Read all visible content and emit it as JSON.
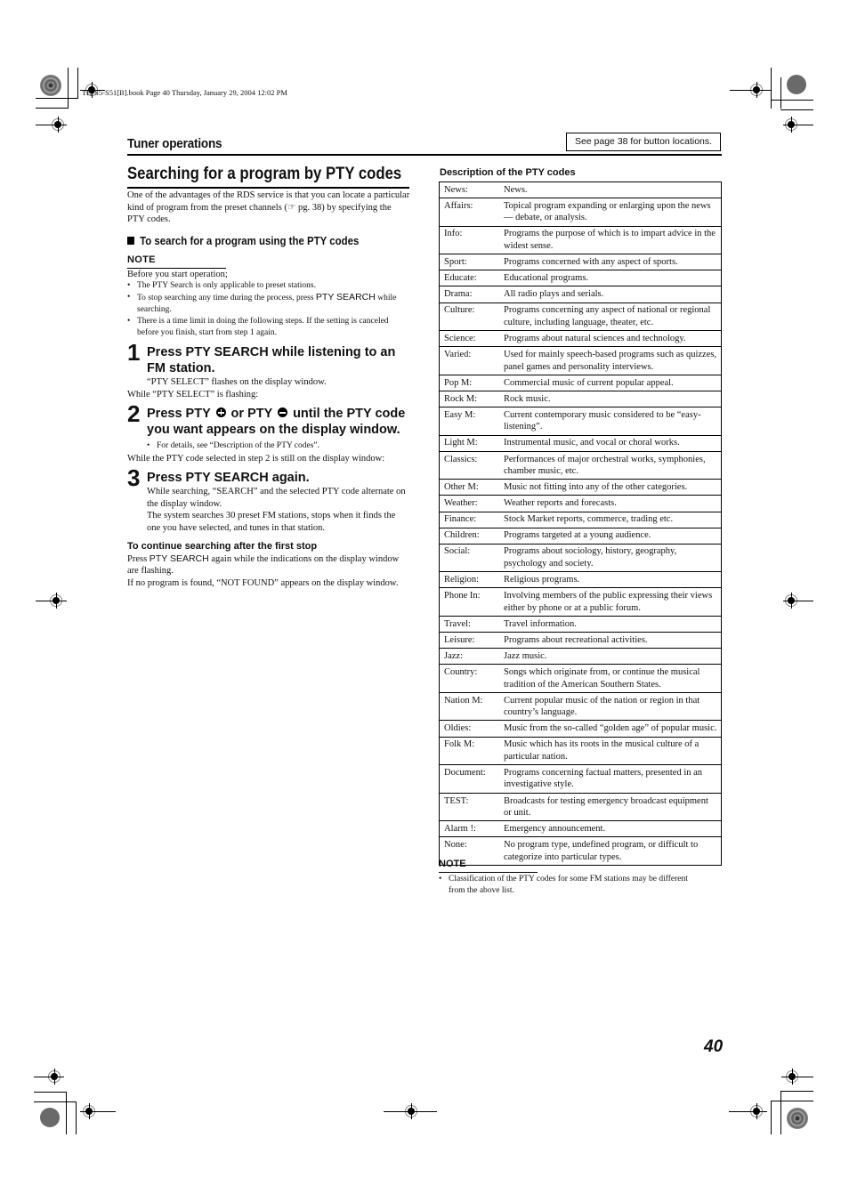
{
  "file_header": "TH-S5-S51[B].book  Page 40  Thursday, January 29, 2004  12:02 PM",
  "section": {
    "title": "Tuner operations",
    "see_page_note": "See page 38 for button locations."
  },
  "left": {
    "title": "Searching for a program by PTY codes",
    "intro": "One of the advantages of the RDS service is that you can locate a particular kind of program from the preset channels (☞ pg. 38) by specifying the PTY codes.",
    "subheading": "To search for a program using the PTY codes",
    "note": {
      "label": "NOTE",
      "lead": "Before you start operation;",
      "items": [
        "The PTY Search is only applicable to preset stations.",
        "To stop searching any time during the process, press",
        "There is a time limit in doing the following steps. If the setting is canceled before you finish, start from step 1 again."
      ],
      "item2_key": "PTY SEARCH",
      "item2_tail": "while searching."
    },
    "steps": [
      {
        "number": "1",
        "title": "Press PTY SEARCH while listening to an FM station.",
        "body": "“PTY SELECT” flashes on the display window."
      },
      {
        "number": "2",
        "title_a": "Press PTY",
        "title_b": "or PTY",
        "title_c": "until the PTY code you want appears on the display window.",
        "bullet": "For details, see “Description of the PTY codes”."
      },
      {
        "number": "3",
        "title": "Press PTY SEARCH again.",
        "body1": "While searching, “SEARCH” and the selected PTY code alternate on the display window.",
        "body2": "The system searches 30 preset FM stations, stops when it finds the one you have selected, and tunes in that station."
      }
    ],
    "between_1_2": "While “PTY SELECT” is flashing:",
    "between_2_3": "While the PTY code selected in step 2 is still on the display window:",
    "continue": {
      "heading": "To continue searching after the first stop",
      "text_a": "Press",
      "key": "PTY SEARCH",
      "text_b": "again while the indications on the display window are flashing.",
      "text_c": "If no program is found, “NOT FOUND” appears on the display window."
    }
  },
  "right": {
    "table_title": "Description of the PTY codes",
    "rows": [
      {
        "code": "News:",
        "desc": "News."
      },
      {
        "code": "Affairs:",
        "desc": "Topical program expanding or enlarging upon the news — debate, or analysis."
      },
      {
        "code": "Info:",
        "desc": "Programs the purpose of which is to impart advice in the widest sense."
      },
      {
        "code": "Sport:",
        "desc": "Programs concerned with any aspect of sports."
      },
      {
        "code": "Educate:",
        "desc": "Educational programs."
      },
      {
        "code": "Drama:",
        "desc": "All radio plays and serials."
      },
      {
        "code": "Culture:",
        "desc": "Programs concerning any aspect of national or regional culture, including language, theater, etc."
      },
      {
        "code": "Science:",
        "desc": "Programs about natural sciences and technology."
      },
      {
        "code": "Varied:",
        "desc": "Used for mainly speech-based programs such as quizzes, panel games and personality interviews."
      },
      {
        "code": "Pop M:",
        "desc": "Commercial music of current popular appeal."
      },
      {
        "code": "Rock M:",
        "desc": "Rock music."
      },
      {
        "code": "Easy M:",
        "desc": "Current contemporary music considered to be “easy-listening”."
      },
      {
        "code": "Light M:",
        "desc": "Instrumental music, and vocal or choral works."
      },
      {
        "code": "Classics:",
        "desc": "Performances of major orchestral works, symphonies, chamber music, etc."
      },
      {
        "code": "Other M:",
        "desc": "Music not fitting into any of the other categories."
      },
      {
        "code": "Weather:",
        "desc": "Weather reports and forecasts."
      },
      {
        "code": "Finance:",
        "desc": "Stock Market reports, commerce, trading etc."
      },
      {
        "code": "Children:",
        "desc": "Programs targeted at a young audience."
      },
      {
        "code": "Social:",
        "desc": "Programs about sociology, history, geography, psychology and society."
      },
      {
        "code": "Religion:",
        "desc": "Religious programs."
      },
      {
        "code": "Phone In:",
        "desc": "Involving members of the public expressing their views either by phone or at a public forum."
      },
      {
        "code": "Travel:",
        "desc": "Travel information."
      },
      {
        "code": "Leisure:",
        "desc": "Programs about recreational activities."
      },
      {
        "code": "Jazz:",
        "desc": "Jazz music."
      },
      {
        "code": "Country:",
        "desc": "Songs which originate from, or continue the musical tradition of the American Southern States."
      },
      {
        "code": "Nation M:",
        "desc": "Current popular music of the nation or region in that country’s language."
      },
      {
        "code": "Oldies:",
        "desc": "Music from the so-called “golden age” of popular music."
      },
      {
        "code": "Folk M:",
        "desc": "Music which has its roots in the musical culture of a particular nation."
      },
      {
        "code": "Document:",
        "desc": "Programs concerning factual matters, presented in an investigative style."
      },
      {
        "code": "TEST:",
        "desc": "Broadcasts for testing emergency broadcast equipment or unit."
      },
      {
        "code": "Alarm !:",
        "desc": "Emergency announcement."
      },
      {
        "code": "None:",
        "desc": "No program type, undefined program, or difficult to categorize into particular types."
      }
    ],
    "note": {
      "label": "NOTE",
      "items": [
        "Classification of the PTY codes for some FM stations may be different from the above list."
      ]
    }
  },
  "page_number": "40",
  "icons": {
    "plus": "pty-plus-icon",
    "minus": "pty-minus-icon",
    "reference": "☞"
  }
}
